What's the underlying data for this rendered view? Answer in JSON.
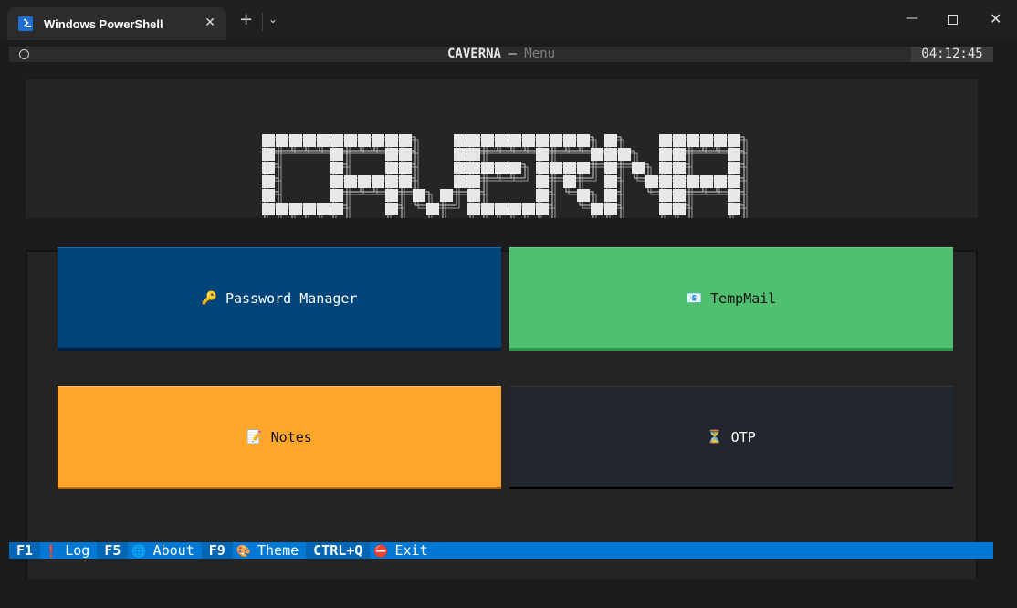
{
  "window": {
    "tab_title": "Windows PowerShell",
    "close_tab": "✕",
    "new_tab": "+",
    "dropdown": "⌄",
    "minimize": "—",
    "close": "✕"
  },
  "header": {
    "app_name": "CAVERNA",
    "separator": " — ",
    "screen": "Menu",
    "clock": "04:12:45"
  },
  "banner": {
    "text": "CAVERNA"
  },
  "menu": [
    {
      "emoji": "🔑",
      "label": "Password Manager",
      "color": "#00457a"
    },
    {
      "emoji": "📧",
      "label": "TempMail",
      "color": "#50c070"
    },
    {
      "emoji": "📝",
      "label": "Notes",
      "color": "#ffa62b"
    },
    {
      "emoji": "⏳",
      "label": "OTP",
      "color": "#22262e"
    }
  ],
  "footer": [
    {
      "key": "F1",
      "emoji": "❗",
      "label": "Log"
    },
    {
      "key": "F5",
      "emoji": "🌐",
      "label": "About"
    },
    {
      "key": "F9",
      "emoji": "🎨",
      "label": "Theme"
    },
    {
      "key": "CTRL+Q",
      "emoji": "⛔",
      "label": "Exit"
    }
  ],
  "colors": {
    "footer_bg": "#0178d4",
    "panel_bg": "#242424"
  }
}
